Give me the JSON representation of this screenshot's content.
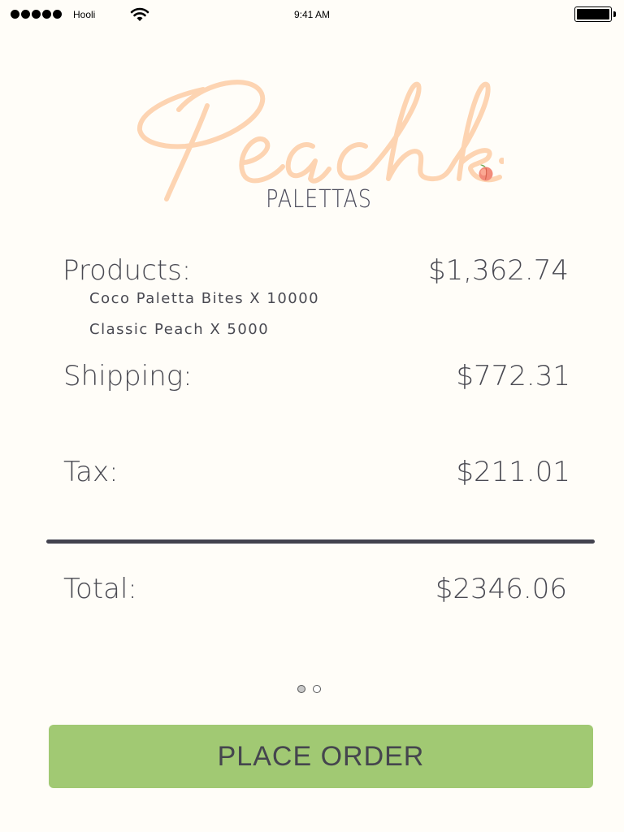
{
  "status_bar": {
    "carrier": "Hooli",
    "time": "9:41 AM",
    "signal_icon": "signal-dots-icon",
    "wifi_icon": "wifi-icon",
    "battery_icon": "battery-icon"
  },
  "logo": {
    "script_text": "Peach",
    "subtitle": "PALETTAS",
    "script_color": "#fdd4b2",
    "icon": "peach-icon"
  },
  "summary": {
    "products": {
      "label": "Products:",
      "value": "$1,362.74",
      "items": [
        "Coco Paletta Bites X 10000",
        "Classic Peach X 5000"
      ]
    },
    "shipping": {
      "label": "Shipping:",
      "value": "$772.31"
    },
    "tax": {
      "label": "Tax:",
      "value": "$211.01"
    },
    "total": {
      "label": "Total:",
      "value": "$2346.06"
    }
  },
  "pagination": {
    "current_page": 1,
    "total_pages": 2
  },
  "button": {
    "label": "PLACE ORDER",
    "color": "#a1c973"
  },
  "colors": {
    "background": "#fffdf8",
    "text": "#4a4a52",
    "divider": "#43434f"
  }
}
